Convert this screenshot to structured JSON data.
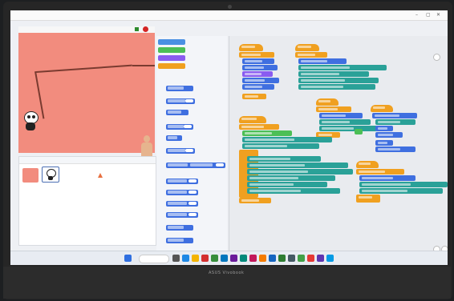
{
  "laptop": {
    "brand": "ASUS Vivobook"
  },
  "window": {
    "title": "",
    "min": "–",
    "max": "▢",
    "close": "✕"
  },
  "menu": [
    "",
    "",
    "",
    "",
    "",
    "",
    ""
  ],
  "palette_tabs": [
    "",
    "",
    ""
  ],
  "sprite_panel": {
    "label": ""
  },
  "taskbar": {
    "weather": "",
    "search_placeholder": "",
    "clock_time": "",
    "clock_date": ""
  },
  "colors": {
    "stage_bg": "#f28c7e",
    "motion_blue": "#3f6fe0",
    "events_orange": "#f0a020",
    "control_teal": "#2aa198",
    "looks_purple": "#8a5cf0",
    "operators_green": "#4cbf56"
  },
  "icons": [
    "green-flag-icon",
    "stop-icon",
    "search-icon",
    "windows-start-icon"
  ]
}
